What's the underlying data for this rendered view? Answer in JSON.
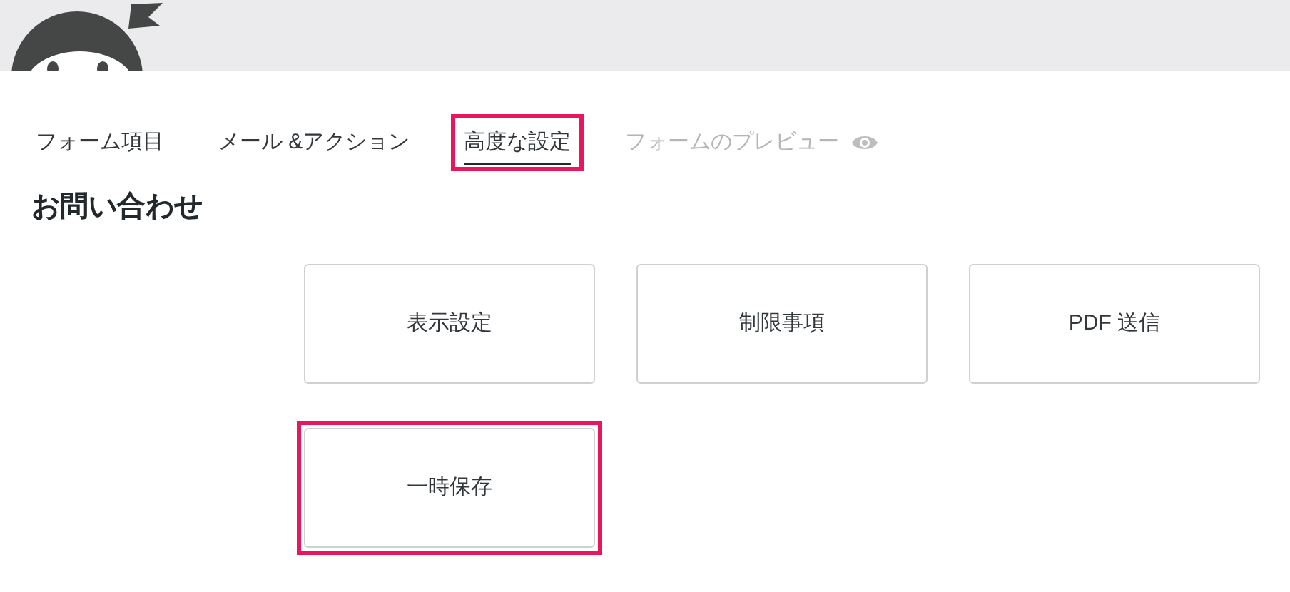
{
  "tabs": [
    {
      "label": "フォーム項目",
      "selected": false,
      "disabled": false,
      "highlighted": false
    },
    {
      "label": "メール &アクション",
      "selected": false,
      "disabled": false,
      "highlighted": false
    },
    {
      "label": "高度な設定",
      "selected": true,
      "disabled": false,
      "highlighted": true
    },
    {
      "label": "フォームのプレビュー",
      "selected": false,
      "disabled": true,
      "highlighted": false,
      "kind": "preview"
    }
  ],
  "form_title": "お問い合わせ",
  "settings_cards": [
    {
      "label": "表示設定",
      "highlighted": false
    },
    {
      "label": "制限事項",
      "highlighted": false
    },
    {
      "label": "PDF 送信",
      "highlighted": false
    },
    {
      "label": "一時保存",
      "highlighted": true
    }
  ]
}
